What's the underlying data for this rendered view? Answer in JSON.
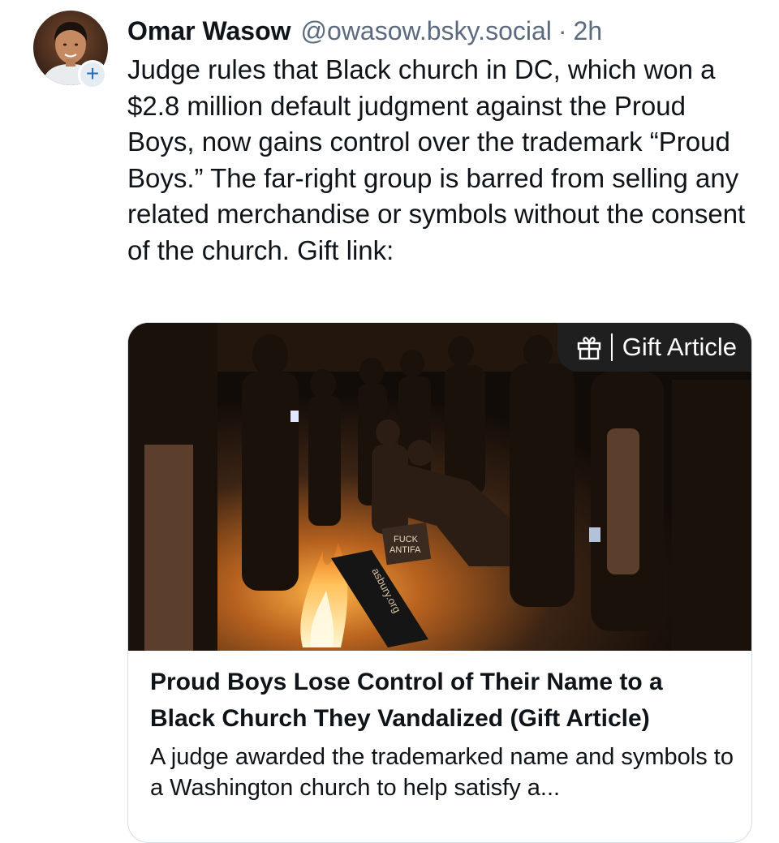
{
  "author": {
    "display_name": "Omar Wasow",
    "handle": "@owasow.bsky.social",
    "separator": "·",
    "time": "2h",
    "avatar_icon": "profile-photo",
    "follow_symbol": "+"
  },
  "post": {
    "text": "Judge rules that Black church in DC, which won a $2.8 million default judgment against the Proud Boys, now gains control over the trademark “Proud Boys.” The far-right group is barred from selling any related merchandise or symbols without the consent of the church. Gift link:"
  },
  "link_card": {
    "badge_label": "Gift Article",
    "badge_icon": "gift-icon",
    "image_text_sign_1": "FUCK",
    "image_text_sign_2": "ANTIFA",
    "image_text_banner": "asbury.org",
    "title": "Proud Boys Lose Control of Their Name to a Black Church They Vandalized (Gift Article)",
    "description": "A judge awarded the trademarked name and symbols to a Washington church to help satisfy a..."
  },
  "colors": {
    "text": "#0f1419",
    "muted": "#5b6b7d",
    "accent": "#1d6fc5",
    "badge_bg": "#1f1f1f",
    "card_border": "#d5dde6"
  }
}
